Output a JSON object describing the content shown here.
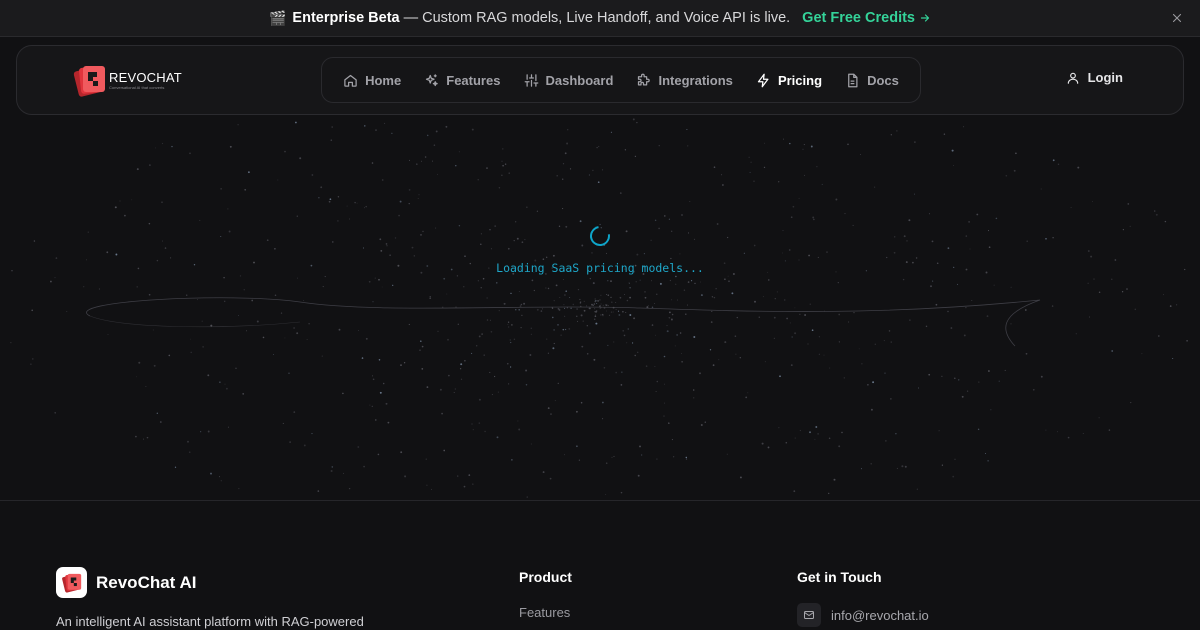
{
  "announcement": {
    "emoji": "🎬",
    "strong": "Enterprise Beta",
    "separator": "—",
    "text": "Custom RAG models, Live Handoff, and Voice API is live.",
    "cta": "Get Free Credits",
    "cta_icon": "arrow-right-icon",
    "close_icon": "close-icon"
  },
  "header": {
    "logo_text": "REVOCHAT",
    "logo_tagline": "Conversational AI that converts",
    "nav": [
      {
        "label": "Home",
        "icon": "home-icon",
        "active": false
      },
      {
        "label": "Features",
        "icon": "sparkles-icon",
        "active": false
      },
      {
        "label": "Dashboard",
        "icon": "sliders-icon",
        "active": false
      },
      {
        "label": "Integrations",
        "icon": "puzzle-icon",
        "active": false
      },
      {
        "label": "Pricing",
        "icon": "bolt-icon",
        "active": true
      },
      {
        "label": "Docs",
        "icon": "document-icon",
        "active": false
      }
    ],
    "login": "Login",
    "login_icon": "user-icon"
  },
  "main": {
    "loading_text": "Loading SaaS pricing models..."
  },
  "footer": {
    "brand_name": "RevoChat AI",
    "description": "An intelligent AI assistant platform with RAG-powered",
    "product_title": "Product",
    "product_links": [
      "Features"
    ],
    "contact_title": "Get in Touch",
    "contact_email": "info@revochat.io"
  },
  "colors": {
    "accent_green": "#34d399",
    "accent_cyan": "#1ea7c9",
    "brand_red": "#e0343c",
    "background": "#111113"
  }
}
